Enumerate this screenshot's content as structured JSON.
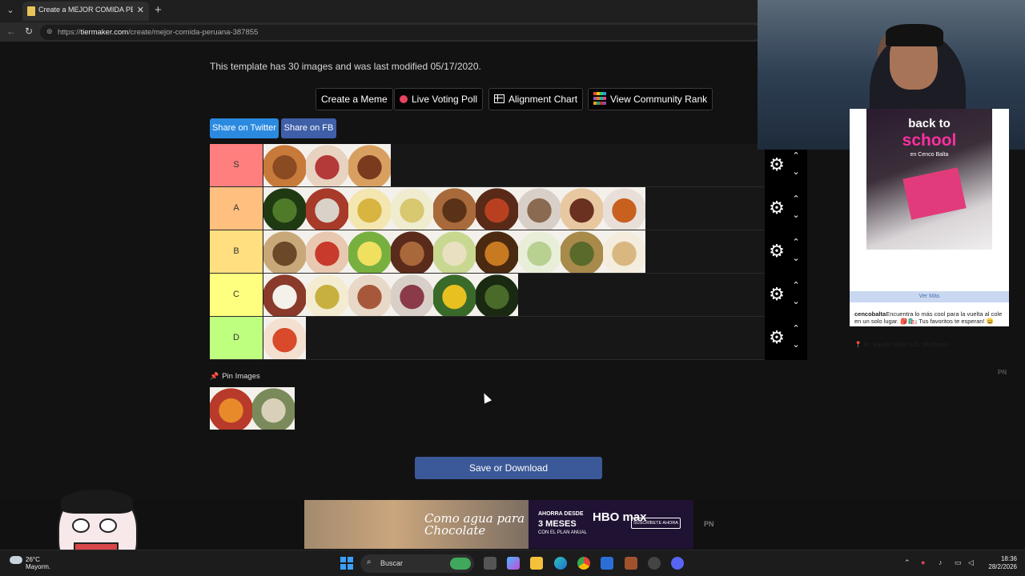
{
  "browser": {
    "tab_title": "Create a MEJOR COMIDA PERUANA",
    "tab_close": "✕",
    "new_tab": "+",
    "url_host_prefix": "https://",
    "url_host": "tiermaker.com",
    "url_path": "/create/mejor-comida-peruana-387855"
  },
  "page": {
    "info_text": "This template has 30 images and was last modified 05/17/2020.",
    "buttons": {
      "create_meme": "Create a Meme",
      "live_voting": "Live Voting Poll",
      "alignment_chart": "Alignment Chart",
      "community_rank": "View Community Rank"
    },
    "share": {
      "twitter": "Share on Twitter",
      "fb": "Share on FB"
    },
    "tiers": [
      {
        "label": "S",
        "color": "#ff7f7f",
        "items": [
          {
            "c1": "#8a4b22",
            "c2": "#c87a3a"
          },
          {
            "c1": "#b43a3a",
            "c2": "#e8d2c0"
          },
          {
            "c1": "#7a3a1e",
            "c2": "#d8a060"
          }
        ]
      },
      {
        "label": "A",
        "color": "#ffbf7f",
        "items": [
          {
            "c1": "#4f7a2a",
            "c2": "#1f3a12"
          },
          {
            "c1": "#d8d2c8",
            "c2": "#a83a2a"
          },
          {
            "c1": "#d8b440",
            "c2": "#f4e6b0"
          },
          {
            "c1": "#d8c870",
            "c2": "#f0ecd0"
          },
          {
            "c1": "#5a3218",
            "c2": "#a86a3a"
          },
          {
            "c1": "#b84020",
            "c2": "#5a2a18"
          },
          {
            "c1": "#8a6a50",
            "c2": "#d8d0c8"
          },
          {
            "c1": "#6a3020",
            "c2": "#e8c8a0"
          },
          {
            "c1": "#c86020",
            "c2": "#e8e0d8"
          }
        ]
      },
      {
        "label": "B",
        "color": "#ffdf7f",
        "items": [
          {
            "c1": "#6a4828",
            "c2": "#c8a878"
          },
          {
            "c1": "#c83a2a",
            "c2": "#e8c8b0"
          },
          {
            "c1": "#f0e060",
            "c2": "#78b040"
          },
          {
            "c1": "#a8683a",
            "c2": "#5a2a1a"
          },
          {
            "c1": "#e8e0c0",
            "c2": "#c8d890"
          },
          {
            "c1": "#c87a20",
            "c2": "#4a2a10"
          },
          {
            "c1": "#b8d090",
            "c2": "#e8eed8"
          },
          {
            "c1": "#5a6a2a",
            "c2": "#a88a4a"
          },
          {
            "c1": "#d8b880",
            "c2": "#f4ecdc"
          }
        ]
      },
      {
        "label": "C",
        "color": "#ffff7f",
        "items": [
          {
            "c1": "#f4f0ea",
            "c2": "#8a3a2a"
          },
          {
            "c1": "#c8b040",
            "c2": "#f4ecd0"
          },
          {
            "c1": "#a8583a",
            "c2": "#e8d8c8"
          },
          {
            "c1": "#8a3a4a",
            "c2": "#d8d0c8"
          },
          {
            "c1": "#e8c020",
            "c2": "#3a6a2a"
          },
          {
            "c1": "#4a6a2a",
            "c2": "#1a2a12"
          }
        ]
      },
      {
        "label": "D",
        "color": "#bfff7f",
        "items": [
          {
            "c1": "#d84a2a",
            "c2": "#f4e0d0"
          }
        ]
      }
    ],
    "pin_label": "Pin Images",
    "pin_items": [
      {
        "c1": "#e88a2a",
        "c2": "#b83a2a"
      },
      {
        "c1": "#d8d0b8",
        "c2": "#7a8a5a"
      }
    ],
    "save_label": "Save or Download"
  },
  "ad_right": {
    "headline_1": "back to",
    "headline_2": "school",
    "headline_3": "en Cenco Balta",
    "more": "Ver Más",
    "account": "cencobalta",
    "desc": "Encuentra lo más cool para la vuelta al cole en un solo lugar. 🎒🛍️¡ Tus favoritos te esperan! 😄",
    "address": "📍 Av. Bajada Balta 626, Miraflores.",
    "pn": "PN"
  },
  "banner": {
    "script_text": "Como agua para Chocolate",
    "offer_1": "AHORRA DESDE",
    "offer_2": "3 MESES",
    "offer_3": "CON EL PLAN ANUAL",
    "brand": "HBO max",
    "cta": "SUSCRÍBETE AHORA",
    "pn": "PN"
  },
  "taskbar": {
    "temp": "26°C",
    "weather_text": "Mayorm.",
    "search": "Buscar",
    "time": "18:36",
    "date": "28/2/2026"
  },
  "icons": {
    "gear": "⚙",
    "up": "⌃",
    "down": "⌄",
    "pin": "📌"
  }
}
